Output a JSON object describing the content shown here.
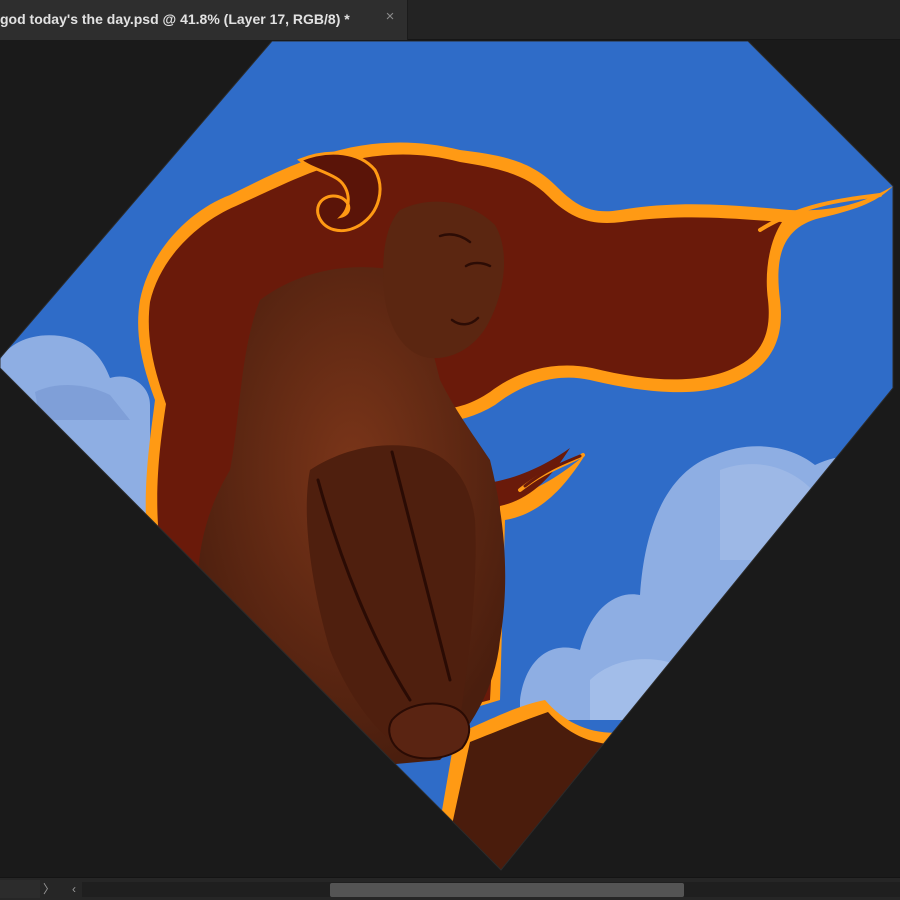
{
  "document_tab": {
    "title": "god today's the day.psd @ 41.8% (Layer 17, RGB/8) *",
    "close_icon": "×"
  },
  "statusbar": {
    "next_icon": "〉",
    "prev_icon": "‹"
  },
  "colors": {
    "sky": "#2f6cc8",
    "cloud": "#8eaee3",
    "rim_light": "#ff9a14",
    "hair": "#6a1a0a",
    "skin_shadow": "#5a2412"
  }
}
